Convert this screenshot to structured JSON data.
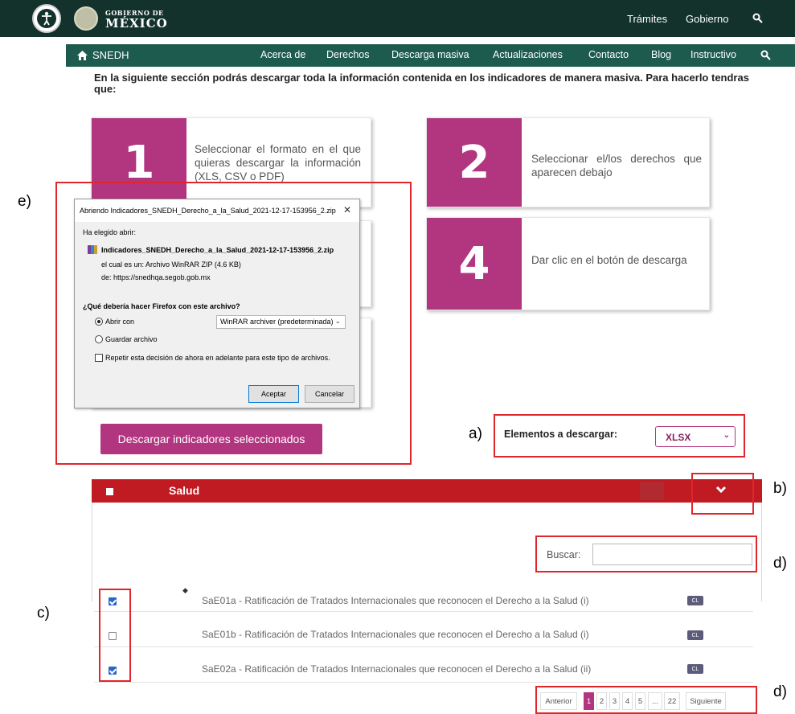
{
  "gov_header": {
    "title_top": "GOBIERNO DE",
    "title_main": "MÉXICO",
    "links": [
      "Trámites",
      "Gobierno"
    ]
  },
  "nav": {
    "home_label": "SNEDH",
    "items": [
      "Acerca de",
      "Derechos",
      "Descarga masiva",
      "Actualizaciones",
      "Contacto",
      "Blog",
      "Instructivo"
    ]
  },
  "intro_text": "En la siguiente sección podrás descargar toda la información contenida en los indicadores de manera masiva. Para hacerlo tendras que:",
  "steps": [
    {
      "number": "1",
      "text": "Seleccionar el formato en el que quieras descargar la información (XLS, CSV o PDF)"
    },
    {
      "number": "2",
      "text": "Seleccionar el/los derechos que aparecen debajo"
    },
    {
      "number": "4",
      "text": "Dar clic en el botón de descarga"
    }
  ],
  "download_button": "Descargar indicadores seleccionados",
  "dialog": {
    "title": "Abriendo Indicadores_SNEDH_Derecho_a_la_Salud_2021-12-17-153956_2.zip",
    "chosen_label": "Ha elegido abrir:",
    "filename": "Indicadores_SNEDH_Derecho_a_la_Salud_2021-12-17-153956_2.zip",
    "type_line": "el cual es un:  Archivo WinRAR ZIP (4.6 KB)",
    "from_line": "de:  https://snedhqa.segob.gob.mx",
    "question": "¿Qué debería hacer Firefox con este archivo?",
    "open_with_label": "Abrir con",
    "open_with_value": "WinRAR archiver (predeterminada)",
    "save_label": "Guardar archivo",
    "repeat_label": "Repetir esta decisión de ahora en adelante para este tipo de archivos.",
    "accept": "Aceptar",
    "cancel": "Cancelar"
  },
  "export": {
    "label": "Elementos a descargar:",
    "value": "XLSX"
  },
  "panel": {
    "title": "Salud",
    "search_label": "Buscar:",
    "search_value": ""
  },
  "rows": [
    {
      "code": "SaE01a",
      "text": " - Ratificación de Tratados Internacionales que reconocen el Derecho a la Salud (i)",
      "checked": true,
      "badge": "CL"
    },
    {
      "code": "SaE01b",
      "text": " - Ratificación de Tratados Internacionales que reconocen el Derecho a la Salud (i)",
      "checked": false,
      "badge": "CL"
    },
    {
      "code": "SaE02a",
      "text": " - Ratificación de Tratados Internacionales que reconocen el Derecho a la Salud (ii)",
      "checked": true,
      "badge": "CL"
    }
  ],
  "pagination": {
    "prev": "Anterior",
    "pages": [
      "1",
      "2",
      "3",
      "4",
      "5",
      "...",
      "22"
    ],
    "current": "1",
    "next": "Siguiente"
  },
  "annotations": [
    "a)",
    "b)",
    "c)",
    "d)",
    "d)",
    "e)"
  ],
  "colors": {
    "gov_green": "#13322b",
    "nav_green": "#1e5b4f",
    "magenta": "#b23580",
    "panel_red": "#c01b22",
    "annotation_red": "#e0262b"
  }
}
